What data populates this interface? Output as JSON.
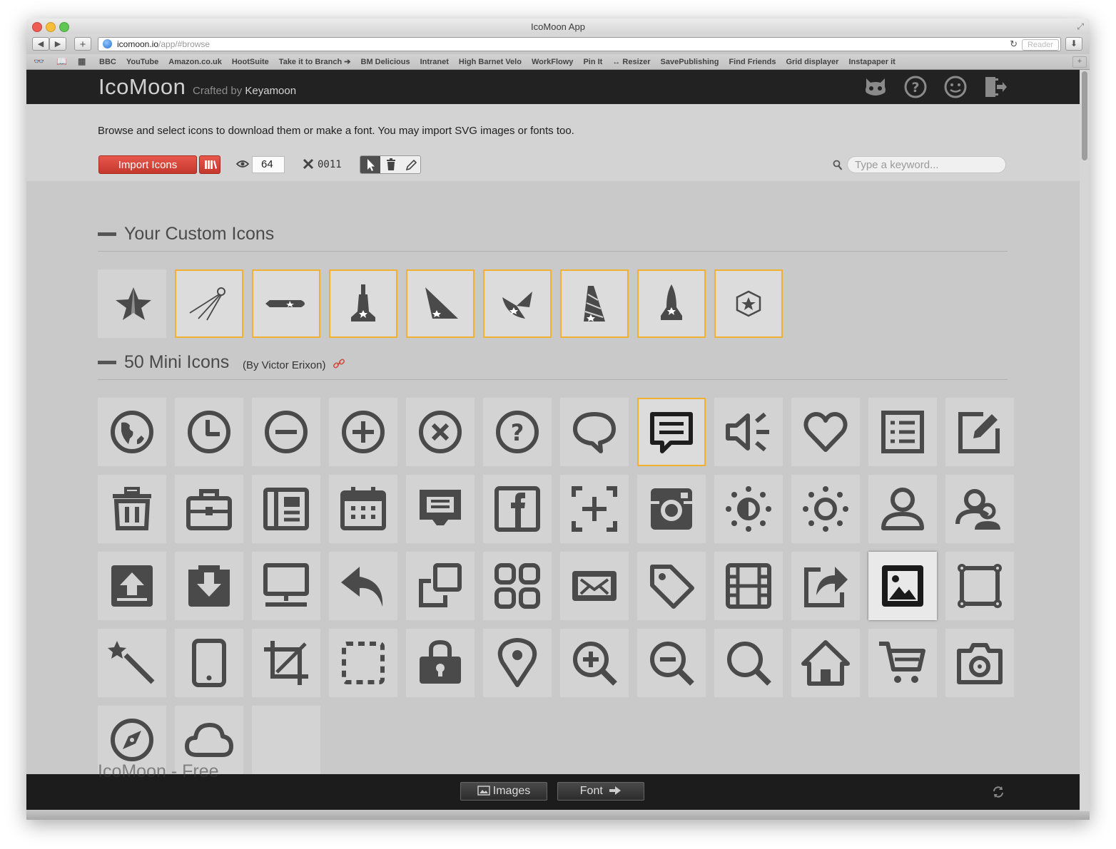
{
  "window": {
    "title": "IcoMoon App"
  },
  "browser": {
    "url_host": "icomoon.io",
    "url_path": "/app/#browse",
    "reader_label": "Reader",
    "bookmarks": [
      "BBC",
      "YouTube",
      "Amazon.co.uk",
      "HootSuite",
      "Take it to Branch ➔",
      "BM Delicious",
      "Intranet",
      "High Barnet Velo",
      "WorkFlowy",
      "Pin It",
      "↔ Resizer",
      "SavePublishing",
      "Find Friends",
      "Grid displayer",
      "Instapaper it"
    ]
  },
  "header": {
    "logo": "IcoMoon",
    "crafted_by": "Crafted by",
    "author": "Keyamoon",
    "icons": [
      "github-icon",
      "help-icon",
      "smiley-icon",
      "logout-icon"
    ]
  },
  "toolbar": {
    "intro": "Browse and select icons to download them or make a font. You may import SVG images or fonts too.",
    "import_label": "Import Icons",
    "size_value": "64",
    "code": "0011",
    "search_placeholder": "Type a keyword..."
  },
  "sections": {
    "custom": {
      "title": "Your Custom Icons",
      "icons": [
        "star-icon",
        "satellite-icon",
        "rocket-icon",
        "tower-icon",
        "sail-icon",
        "dish-icon",
        "drill-tower-icon",
        "shuttle-icon",
        "polyhedron-icon"
      ]
    },
    "mini": {
      "title": "50 Mini Icons",
      "by_prefix": "(By",
      "author": "Victor Erixon",
      "by_suffix": ")"
    },
    "next_ghost": "IcoMoon - Free"
  },
  "mini_icons": [
    "globe-icon",
    "clock-icon",
    "minus-circle-icon",
    "plus-circle-icon",
    "close-circle-icon",
    "question-circle-icon",
    "speech-bubble-icon",
    "chat-icon",
    "volume-icon",
    "heart-icon",
    "list-icon",
    "edit-icon",
    "trash-icon",
    "briefcase-icon",
    "newspaper-icon",
    "calendar-icon",
    "inbox-icon",
    "facebook-icon",
    "add-frame-icon",
    "instagram-icon",
    "brightness-low-icon",
    "brightness-high-icon",
    "user-icon",
    "users-icon",
    "upload-icon",
    "download-icon",
    "monitor-icon",
    "reply-icon",
    "copy-icon",
    "grid-icon",
    "mail-icon",
    "tag-icon",
    "film-icon",
    "share-icon",
    "image-icon",
    "crop-frame-icon",
    "magic-wand-icon",
    "mobile-icon",
    "crop-icon",
    "selection-icon",
    "lock-icon",
    "location-icon",
    "zoom-in-icon",
    "zoom-out-icon",
    "search-icon",
    "home-icon",
    "cart-icon",
    "camera-icon",
    "compass-icon",
    "cloud-icon"
  ],
  "footer": {
    "images_label": "Images",
    "font_label": "Font"
  },
  "colors": {
    "accent_red": "#d9473c",
    "selection_border": "#f0b132",
    "header_bg": "#222222"
  }
}
